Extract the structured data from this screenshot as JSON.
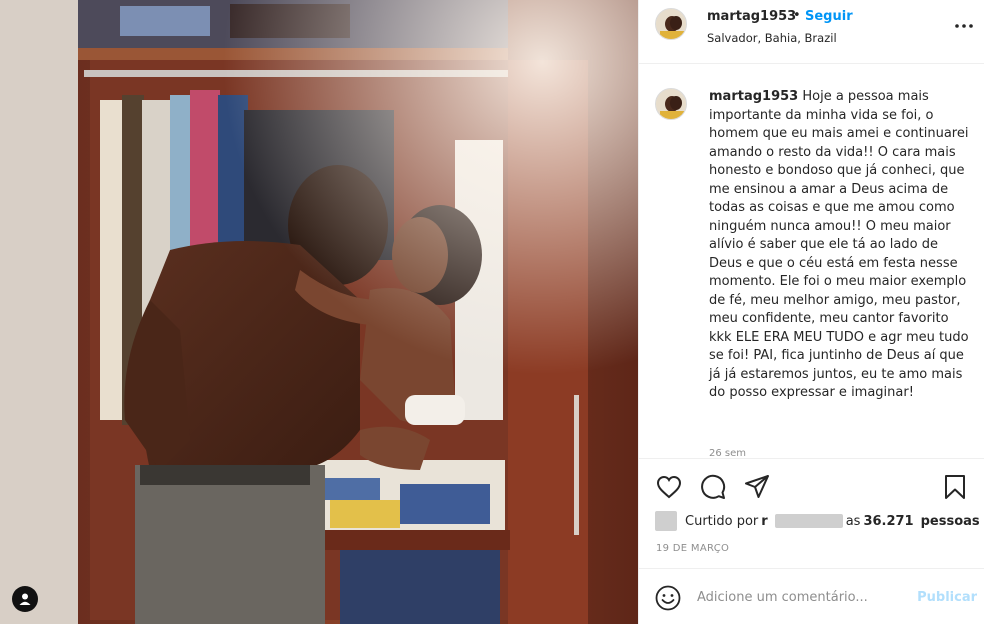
{
  "post": {
    "image_alt": "Foto antiga de um homem sem camisa beijando uma criança pequena sentada em um armário"
  },
  "header": {
    "username": "martag1953",
    "separator": "•",
    "follow_label": "Seguir",
    "location": "Salvador, Bahia, Brazil",
    "more_icon": "more-horizontal-icon"
  },
  "caption": {
    "username": "martag1953",
    "text": "Hoje a pessoa mais importante da minha vida se foi, o homem que eu mais amei e continuarei amando o resto da vida!! O cara mais honesto e bondoso que já conheci, que me ensinou a amar a Deus acima de todas as coisas e que me amou como ninguém nunca amou!! O meu maior alívio é saber que ele tá ao lado de Deus e que o céu está em festa nesse momento. Ele foi o meu maior exemplo de fé, meu melhor amigo, meu pastor, meu confidente, meu cantor favorito kkk ELE ERA MEU TUDO e agr meu tudo se foi! PAI, fica juntinho de Deus aí que já já estaremos juntos, eu te amo mais do posso expressar e imaginar!",
    "time": "26 sem"
  },
  "actions": {
    "like_icon": "heart-icon",
    "comment_icon": "comment-icon",
    "share_icon": "paper-plane-icon",
    "save_icon": "bookmark-icon"
  },
  "likes": {
    "prefix": "Curtido por",
    "initial": "r",
    "and_label": "as",
    "count": "36.271",
    "suffix": "pessoas"
  },
  "date": "19 DE MARÇO",
  "comment_bar": {
    "placeholder": "Adicione um comentário...",
    "publish_label": "Publicar"
  },
  "colors": {
    "accent": "#0095f6",
    "publish_disabled": "#b2dffc",
    "text": "#262626",
    "muted": "#8e8e8e",
    "divider": "#efefef"
  }
}
